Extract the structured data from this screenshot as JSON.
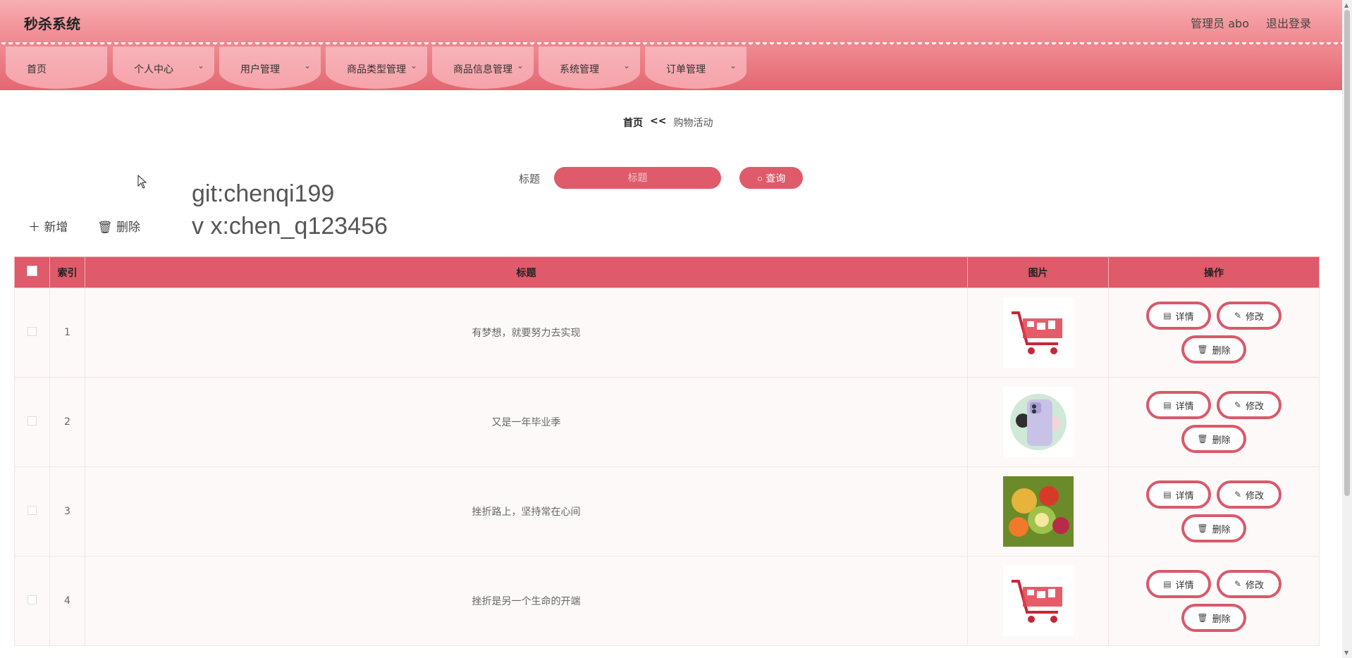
{
  "header": {
    "brand": "秒杀系统",
    "admin_label": "管理员 abo",
    "logout_label": "退出登录"
  },
  "nav": {
    "items": [
      {
        "label": "首页",
        "has_chevron": false
      },
      {
        "label": "个人中心",
        "has_chevron": true
      },
      {
        "label": "用户管理",
        "has_chevron": true
      },
      {
        "label": "商品类型管理",
        "has_chevron": true
      },
      {
        "label": "商品信息管理",
        "has_chevron": true
      },
      {
        "label": "系统管理",
        "has_chevron": true
      },
      {
        "label": "订单管理",
        "has_chevron": true
      }
    ],
    "chevron_glyph": "⌄"
  },
  "breadcrumb": {
    "home": "首页",
    "separator": "<<",
    "current": "购物活动"
  },
  "search": {
    "label": "标题",
    "placeholder": "标题",
    "button_label": "查询"
  },
  "watermark": {
    "line1": "git:chenqi199",
    "line2": "v x:chen_q123456"
  },
  "actions": {
    "add_label": "新增",
    "delete_label": "删除"
  },
  "table": {
    "headers": {
      "index": "索引",
      "title": "标题",
      "image": "图片",
      "operations": "操作"
    },
    "rows": [
      {
        "index": "1",
        "title": "有梦想，就要努力去实现",
        "image": "shopping-cart"
      },
      {
        "index": "2",
        "title": "又是一年毕业季",
        "image": "phone"
      },
      {
        "index": "3",
        "title": "挫折路上，坚持常在心间",
        "image": "fruit"
      },
      {
        "index": "4",
        "title": "挫折是另一个生命的开端",
        "image": "shopping-cart"
      }
    ],
    "op_labels": {
      "detail": "详情",
      "edit": "修改",
      "delete": "删除"
    }
  },
  "colors": {
    "primary": "#df5a6a",
    "header_top": "#f6aeb2",
    "nav_item": "#f7b3b8",
    "row_bg": "#fdf9f9"
  }
}
